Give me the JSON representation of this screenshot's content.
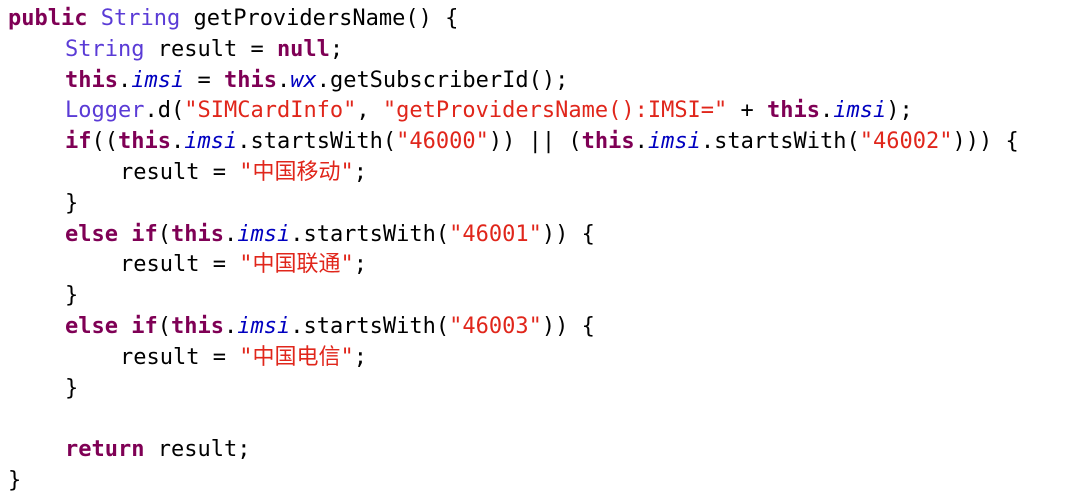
{
  "code": {
    "lines": [
      {
        "indent": 0,
        "tokens": [
          {
            "t": "kw",
            "v": "public"
          },
          {
            "t": "plain",
            "v": " "
          },
          {
            "t": "type",
            "v": "String"
          },
          {
            "t": "plain",
            "v": " getProvidersName() {"
          }
        ]
      },
      {
        "indent": 1,
        "tokens": [
          {
            "t": "type",
            "v": "String"
          },
          {
            "t": "plain",
            "v": " result = "
          },
          {
            "t": "kw",
            "v": "null"
          },
          {
            "t": "plain",
            "v": ";"
          }
        ]
      },
      {
        "indent": 1,
        "tokens": [
          {
            "t": "kw",
            "v": "this"
          },
          {
            "t": "plain",
            "v": "."
          },
          {
            "t": "field",
            "v": "imsi"
          },
          {
            "t": "plain",
            "v": " = "
          },
          {
            "t": "kw",
            "v": "this"
          },
          {
            "t": "plain",
            "v": "."
          },
          {
            "t": "field",
            "v": "wx"
          },
          {
            "t": "plain",
            "v": ".getSubscriberId();"
          }
        ]
      },
      {
        "indent": 1,
        "tokens": [
          {
            "t": "type",
            "v": "Logger"
          },
          {
            "t": "plain",
            "v": ".d("
          },
          {
            "t": "str-cn",
            "v": "\"SIMCardInfo\""
          },
          {
            "t": "plain",
            "v": ", "
          },
          {
            "t": "str-cn",
            "v": "\"getProvidersName():IMSI=\""
          },
          {
            "t": "plain",
            "v": " + "
          },
          {
            "t": "kw",
            "v": "this"
          },
          {
            "t": "plain",
            "v": "."
          },
          {
            "t": "field",
            "v": "imsi"
          },
          {
            "t": "plain",
            "v": ");"
          }
        ]
      },
      {
        "indent": 1,
        "tokens": [
          {
            "t": "kw",
            "v": "if"
          },
          {
            "t": "plain",
            "v": "(("
          },
          {
            "t": "kw",
            "v": "this"
          },
          {
            "t": "plain",
            "v": "."
          },
          {
            "t": "field",
            "v": "imsi"
          },
          {
            "t": "plain",
            "v": ".startsWith("
          },
          {
            "t": "str-cn",
            "v": "\"46000\""
          },
          {
            "t": "plain",
            "v": ")) || ("
          },
          {
            "t": "kw",
            "v": "this"
          },
          {
            "t": "plain",
            "v": "."
          },
          {
            "t": "field",
            "v": "imsi"
          },
          {
            "t": "plain",
            "v": ".startsWith("
          },
          {
            "t": "str-cn",
            "v": "\"46002\""
          },
          {
            "t": "plain",
            "v": "))) {"
          }
        ]
      },
      {
        "indent": 2,
        "tokens": [
          {
            "t": "plain",
            "v": "result = "
          },
          {
            "t": "str-cn",
            "v": "\"中国移动\""
          },
          {
            "t": "plain",
            "v": ";"
          }
        ]
      },
      {
        "indent": 1,
        "tokens": [
          {
            "t": "plain",
            "v": "}"
          }
        ]
      },
      {
        "indent": 1,
        "tokens": [
          {
            "t": "kw",
            "v": "else"
          },
          {
            "t": "plain",
            "v": " "
          },
          {
            "t": "kw",
            "v": "if"
          },
          {
            "t": "plain",
            "v": "("
          },
          {
            "t": "kw",
            "v": "this"
          },
          {
            "t": "plain",
            "v": "."
          },
          {
            "t": "field",
            "v": "imsi"
          },
          {
            "t": "plain",
            "v": ".startsWith("
          },
          {
            "t": "str-cn",
            "v": "\"46001\""
          },
          {
            "t": "plain",
            "v": ")) {"
          }
        ]
      },
      {
        "indent": 2,
        "tokens": [
          {
            "t": "plain",
            "v": "result = "
          },
          {
            "t": "str-cn",
            "v": "\"中国联通\""
          },
          {
            "t": "plain",
            "v": ";"
          }
        ]
      },
      {
        "indent": 1,
        "tokens": [
          {
            "t": "plain",
            "v": "}"
          }
        ]
      },
      {
        "indent": 1,
        "tokens": [
          {
            "t": "kw",
            "v": "else"
          },
          {
            "t": "plain",
            "v": " "
          },
          {
            "t": "kw",
            "v": "if"
          },
          {
            "t": "plain",
            "v": "("
          },
          {
            "t": "kw",
            "v": "this"
          },
          {
            "t": "plain",
            "v": "."
          },
          {
            "t": "field",
            "v": "imsi"
          },
          {
            "t": "plain",
            "v": ".startsWith("
          },
          {
            "t": "str-cn",
            "v": "\"46003\""
          },
          {
            "t": "plain",
            "v": ")) {"
          }
        ]
      },
      {
        "indent": 2,
        "tokens": [
          {
            "t": "plain",
            "v": "result = "
          },
          {
            "t": "str-cn",
            "v": "\"中国电信\""
          },
          {
            "t": "plain",
            "v": ";"
          }
        ]
      },
      {
        "indent": 1,
        "tokens": [
          {
            "t": "plain",
            "v": "}"
          }
        ]
      },
      {
        "indent": 0,
        "tokens": []
      },
      {
        "indent": 1,
        "tokens": [
          {
            "t": "kw",
            "v": "return"
          },
          {
            "t": "plain",
            "v": " result;"
          }
        ]
      },
      {
        "indent": 0,
        "tokens": [
          {
            "t": "plain",
            "v": "}"
          }
        ]
      }
    ]
  },
  "colors": {
    "keyword": "#7f0055",
    "type": "#5a3bd6",
    "string": "#e0261b",
    "field": "#0000c0",
    "text": "#000000",
    "background": "#ffffff"
  }
}
